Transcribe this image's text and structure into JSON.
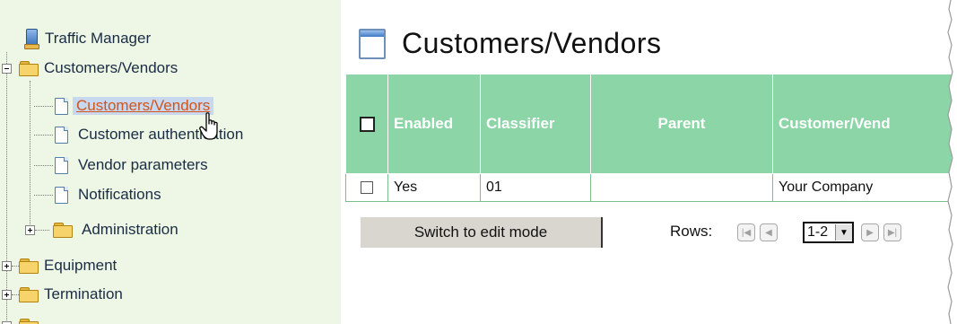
{
  "tree": {
    "root": "Traffic Manager",
    "customers_vendors": "Customers/Vendors",
    "children": {
      "customers_vendors": "Customers/Vendors",
      "customer_auth": "Customer authentication",
      "vendor_params": "Vendor parameters",
      "notifications": "Notifications",
      "administration": "Administration"
    },
    "equipment": "Equipment",
    "termination": "Termination"
  },
  "main": {
    "title": "Customers/Vendors",
    "columns": [
      "Enabled",
      "Classifier",
      "Parent",
      "Customer/Vend"
    ],
    "rows": [
      {
        "enabled": "Yes",
        "classifier": "01",
        "parent": "",
        "customer": "Your Company"
      }
    ],
    "edit_button": "Switch to edit mode",
    "rows_label": "Rows:",
    "page_value": "1-2"
  },
  "colors": {
    "tree_bg": "#eef7e6",
    "header_bg": "#8cd5a7",
    "selected_link": "#d2541b"
  }
}
